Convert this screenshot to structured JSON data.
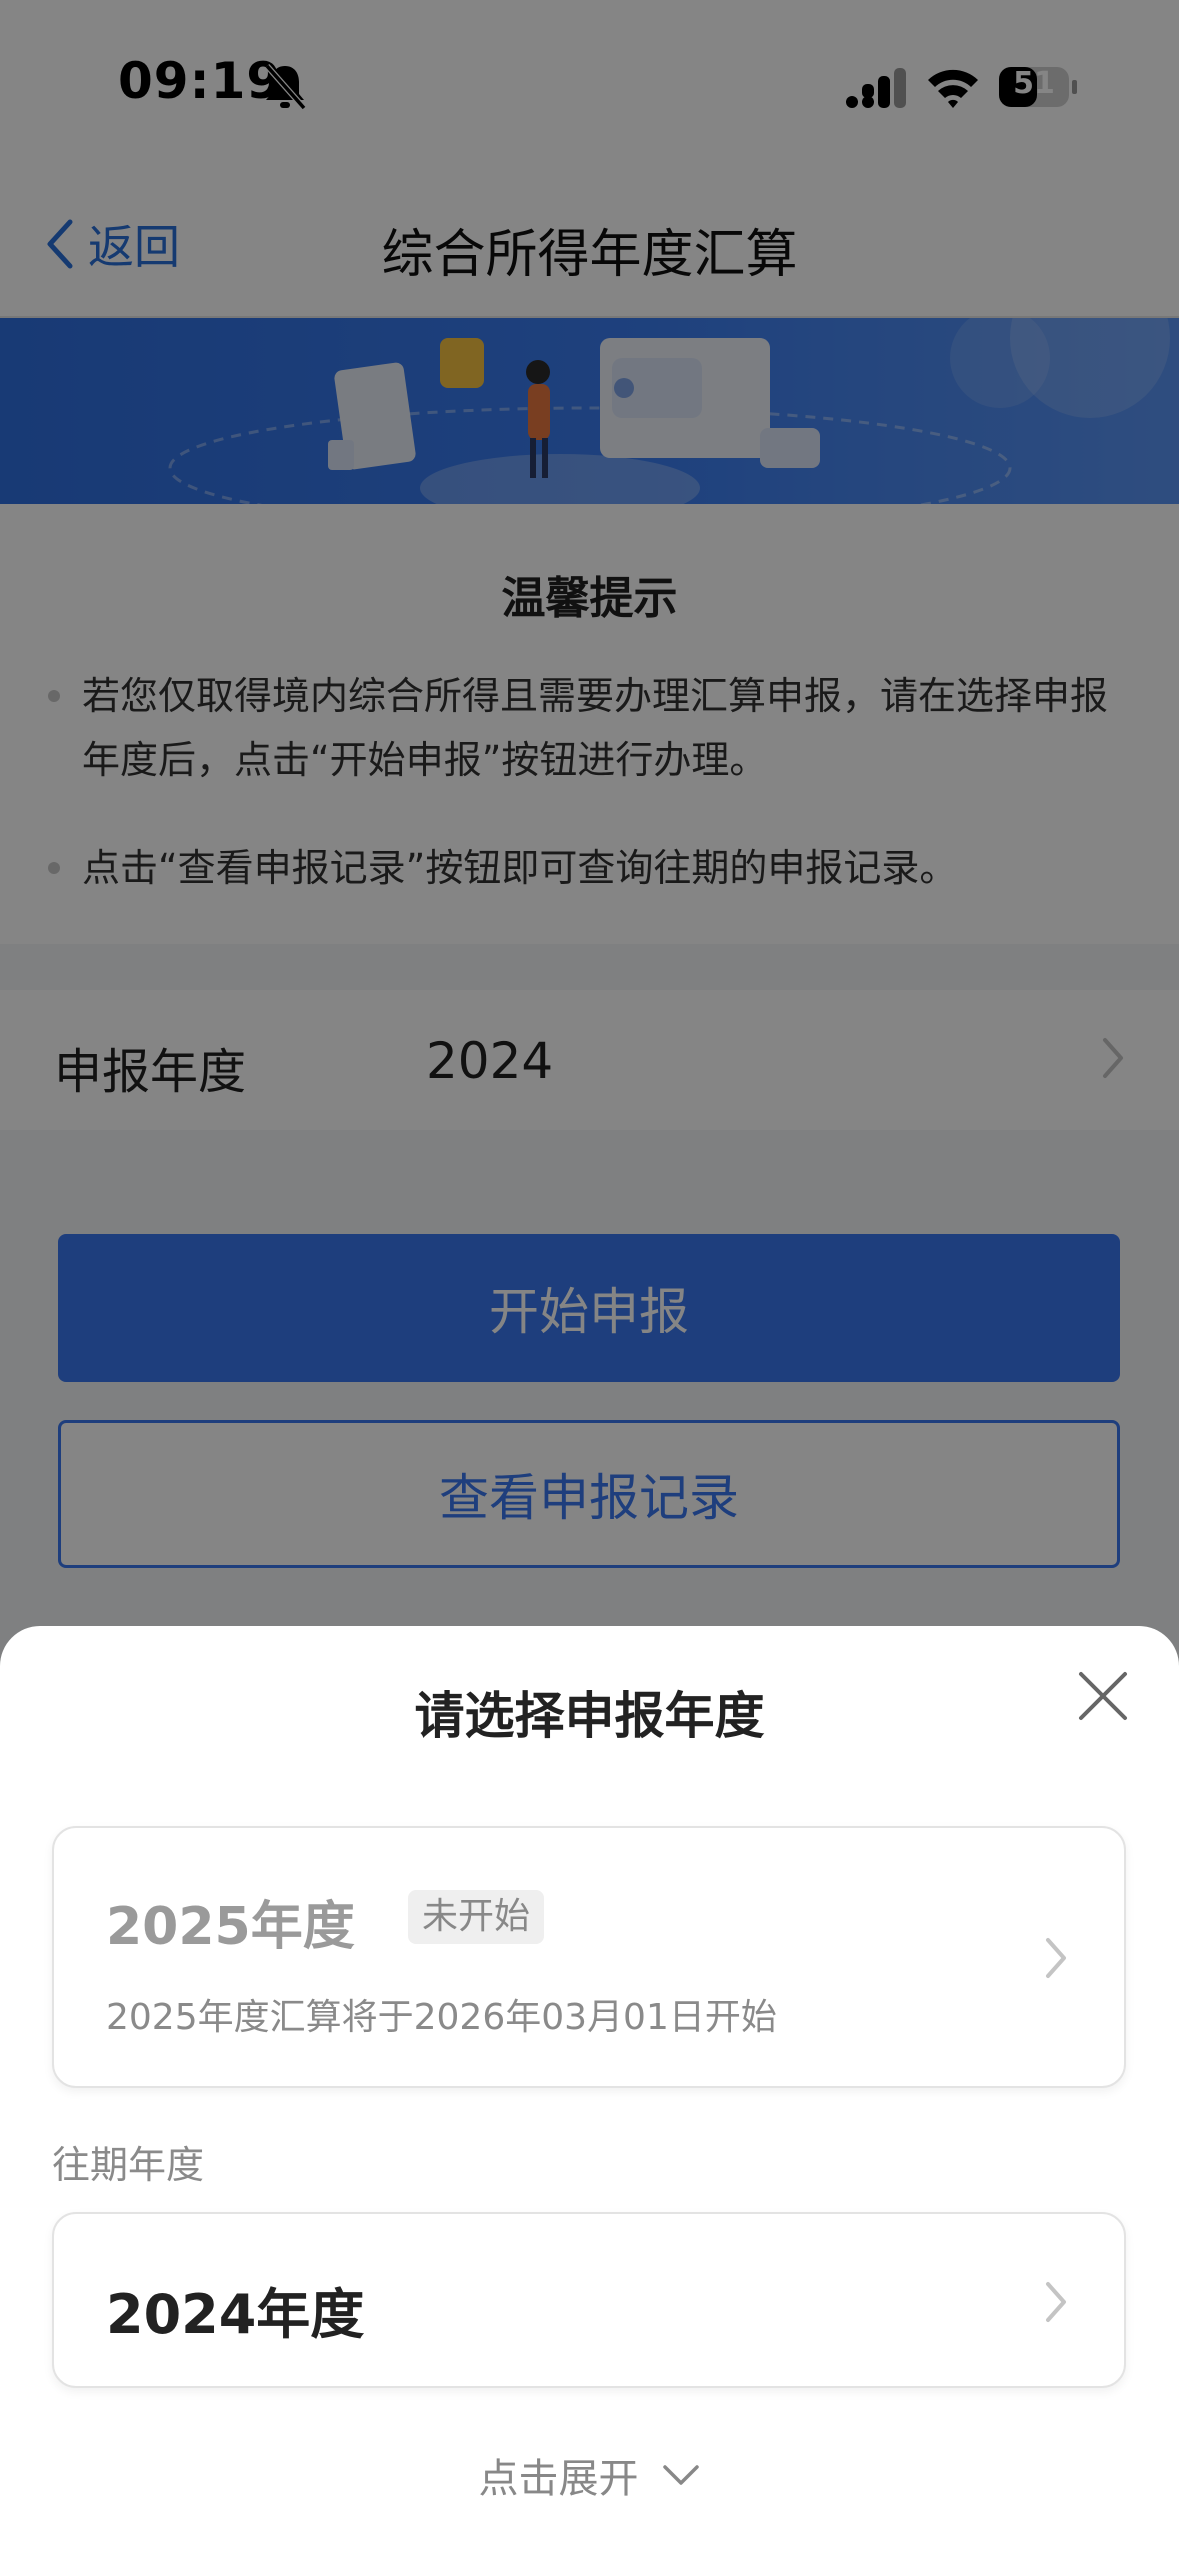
{
  "status_bar": {
    "time": "09:19",
    "battery": "51"
  },
  "nav": {
    "back_label": "返回",
    "title": "综合所得年度汇算"
  },
  "tips": {
    "title": "温馨提示",
    "items": [
      "若您仅取得境内综合所得且需要办理汇算申报，请在选择申报年度后，点击“开始申报”按钮进行办理。",
      "点击“查看申报记录”按钮即可查询往期的申报记录。"
    ]
  },
  "year_row": {
    "label": "申报年度",
    "value": "2024"
  },
  "buttons": {
    "start": "开始申报",
    "records": "查看申报记录"
  },
  "sheet": {
    "title": "请选择申报年度",
    "current_card": {
      "title": "2025年度",
      "badge": "未开始",
      "description": "2025年度汇算将于2026年03月01日开始"
    },
    "past_label": "往期年度",
    "past_card": {
      "title": "2024年度"
    },
    "expand_label": "点击展开"
  },
  "colors": {
    "primary": "#3b78f0",
    "overlay": "rgba(0,0,0,0.48)"
  }
}
